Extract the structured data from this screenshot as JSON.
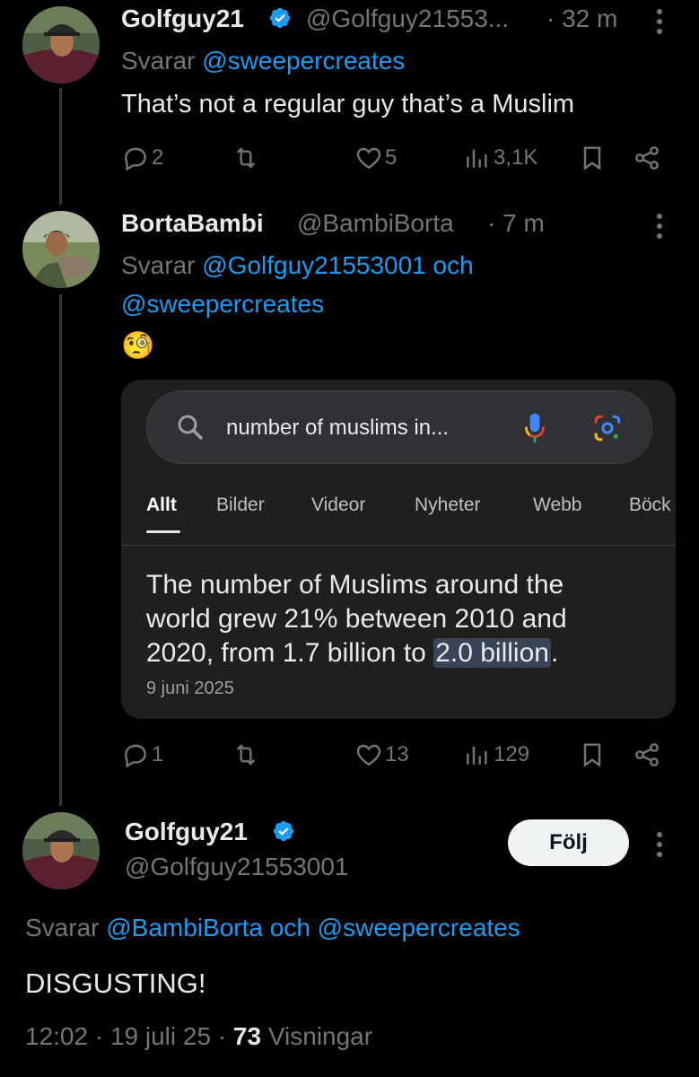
{
  "tweet1": {
    "display_name": "Golfguy21",
    "handle": "@Golfguy21553...",
    "time": "· 32 m",
    "reply_prefix": "Svarar ",
    "reply_to": "@sweepercreates",
    "text": "That’s not a regular guy that’s a Muslim",
    "actions": {
      "replies": "2",
      "likes": "5",
      "views": "3,1K"
    }
  },
  "tweet2": {
    "display_name": "BortaBambi",
    "handle": "@BambiBorta",
    "time": "· 7 m",
    "reply_prefix": "Svarar ",
    "reply_to_line1": "@Golfguy21553001 och",
    "reply_to_line2": "@sweepercreates",
    "emoji": "🧐",
    "actions": {
      "replies": "1",
      "likes": "13",
      "views": "129"
    },
    "search_card": {
      "query": "number of muslims in...",
      "tabs": [
        "Allt",
        "Bilder",
        "Videor",
        "Nyheter",
        "Webb",
        "Böck"
      ],
      "snippet_line1": "The number of Muslims around the",
      "snippet_line2": "world grew 21% between 2010 and",
      "snippet_line3_pre": "2020, from 1.7 billion to ",
      "snippet_highlight": "2.0 billion",
      "snippet_line3_post": ".",
      "date": "9 juni 2025"
    }
  },
  "tweet3": {
    "display_name": "Golfguy21",
    "handle": "@Golfguy21553001",
    "follow_label": "Följ",
    "reply_prefix": "Svarar ",
    "reply_to_a": "@BambiBorta",
    "reply_and": " och ",
    "reply_to_b": "@sweepercreates",
    "text": "DISGUSTING!",
    "time": "12:02 · 19 juli 25 · ",
    "views_count": "73",
    "views_label": " Visningar"
  },
  "colors": {
    "link": "#1d9bf0",
    "verified": "#1d9bf0",
    "muted": "#71767b",
    "background": "#000000"
  }
}
